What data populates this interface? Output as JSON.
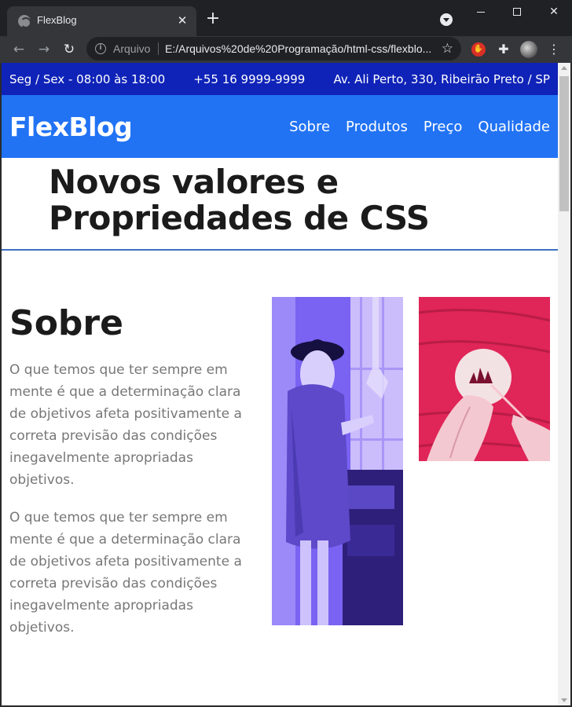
{
  "browser": {
    "tab_title": "FlexBlog",
    "url_scheme": "Arquivo",
    "url": "E:/Arquivos%20de%20Programação/html-css/flexblo..."
  },
  "site": {
    "topbar": {
      "hours": "Seg / Sex - 08:00 às 18:00",
      "phone": "+55 16 9999-9999",
      "address": "Av. Ali Perto, 330, Ribeirão Preto / SP"
    },
    "logo": "FlexBlog",
    "nav": [
      "Sobre",
      "Produtos",
      "Preço",
      "Qualidade"
    ],
    "hero_title_line1": "Novos valores e",
    "hero_title_line2": "Propriedades de CSS",
    "sobre": {
      "heading": "Sobre",
      "paragraphs": [
        "O que temos que ter sempre em mente é que a determinação clara de objetivos afeta positivamente a correta previsão das condições inegavelmente apropriadas objetivos.",
        "O que temos que ter sempre em mente é que a determinação clara de objetivos afeta positivamente a correta previsão das condições inegavelmente apropriadas objetivos."
      ]
    }
  },
  "colors": {
    "topbar_bg": "#0f23b8",
    "header_bg": "#2173f4",
    "image_tint_purple": "#5b3df0",
    "image_tint_pink": "#e8285f"
  }
}
